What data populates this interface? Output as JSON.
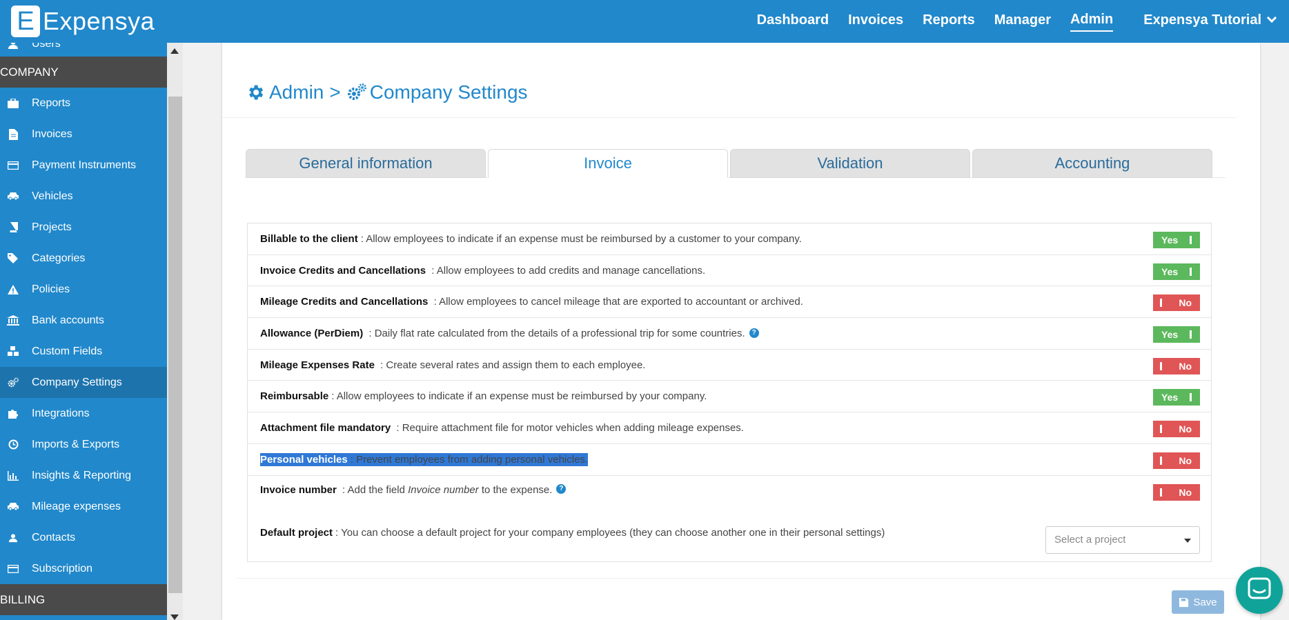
{
  "brand": {
    "letter": "E",
    "name": "Expensya"
  },
  "topnav": {
    "items": [
      "Dashboard",
      "Invoices",
      "Reports",
      "Manager",
      "Admin"
    ],
    "active": "Admin",
    "account": "Expensya Tutorial"
  },
  "sidebar": {
    "users": "Users",
    "company_head": "COMPANY",
    "items": [
      {
        "label": "Reports",
        "icon": "briefcase-icon"
      },
      {
        "label": "Invoices",
        "icon": "file-icon"
      },
      {
        "label": "Payment Instruments",
        "icon": "credit-card-icon"
      },
      {
        "label": "Vehicles",
        "icon": "car-icon"
      },
      {
        "label": "Projects",
        "icon": "book-icon"
      },
      {
        "label": "Categories",
        "icon": "tags-icon"
      },
      {
        "label": "Policies",
        "icon": "warning-icon"
      },
      {
        "label": "Bank accounts",
        "icon": "bank-icon"
      },
      {
        "label": "Custom Fields",
        "icon": "cubes-icon"
      },
      {
        "label": "Company Settings",
        "icon": "gears-icon"
      },
      {
        "label": "Integrations",
        "icon": "puzzle-icon"
      },
      {
        "label": "Imports & Exports",
        "icon": "history-icon"
      },
      {
        "label": "Insights & Reporting",
        "icon": "bar-chart-icon"
      },
      {
        "label": "Mileage expenses",
        "icon": "car-icon"
      },
      {
        "label": "Contacts",
        "icon": "user-icon"
      },
      {
        "label": "Subscription",
        "icon": "credit-card-icon"
      }
    ],
    "active": "Company Settings",
    "billing_head": "BILLING"
  },
  "page": {
    "crumb_admin": "Admin",
    "crumb_sep": ">",
    "crumb_current": "Company Settings"
  },
  "tabs": {
    "items": [
      "General information",
      "Invoice",
      "Validation",
      "Accounting"
    ],
    "active": "Invoice"
  },
  "settings": [
    {
      "title": "Billable to the client",
      "desc": ": Allow employees to indicate if an expense must be reimbursed by a customer to your company.",
      "value": "Yes"
    },
    {
      "title": "Invoice Credits and Cancellations",
      "desc": " : Allow employees to add credits and manage cancellations.",
      "value": "Yes"
    },
    {
      "title": "Mileage Credits and Cancellations",
      "desc": " : Allow employees to cancel mileage that are exported to accountant or archived.",
      "value": "No"
    },
    {
      "title": "Allowance (PerDiem)",
      "desc": " : Daily flat rate calculated from the details of a professional trip for some countries.",
      "value": "Yes",
      "help": true
    },
    {
      "title": "Mileage Expenses Rate",
      "desc": " : Create several rates and assign them to each employee.",
      "value": "No"
    },
    {
      "title": "Reimbursable",
      "desc": ": Allow employees to indicate if an expense must be reimbursed by your company.",
      "value": "Yes"
    },
    {
      "title": "Attachment file mandatory",
      "desc": " : Require attachment file for motor vehicles when adding mileage expenses.",
      "value": "No"
    },
    {
      "title": "Personal vehicles",
      "desc": ": Prevent employees from adding personal vehicles.",
      "value": "No",
      "selected": true
    },
    {
      "title": "Invoice number",
      "desc_pre": " : Add the field ",
      "desc_em": "Invoice number",
      "desc_post": " to the expense.",
      "value": "No",
      "help": true
    }
  ],
  "default_project": {
    "title": "Default project",
    "desc": " : You can choose a default project for your company employees (they can choose another one in their personal settings)",
    "placeholder": "Select a project"
  },
  "save_label": "Save",
  "help_glyph": "?",
  "colors": {
    "primary": "#2188cb",
    "yes": "#5cb85c",
    "no": "#e05555",
    "dark_head": "#4a4a4a"
  }
}
